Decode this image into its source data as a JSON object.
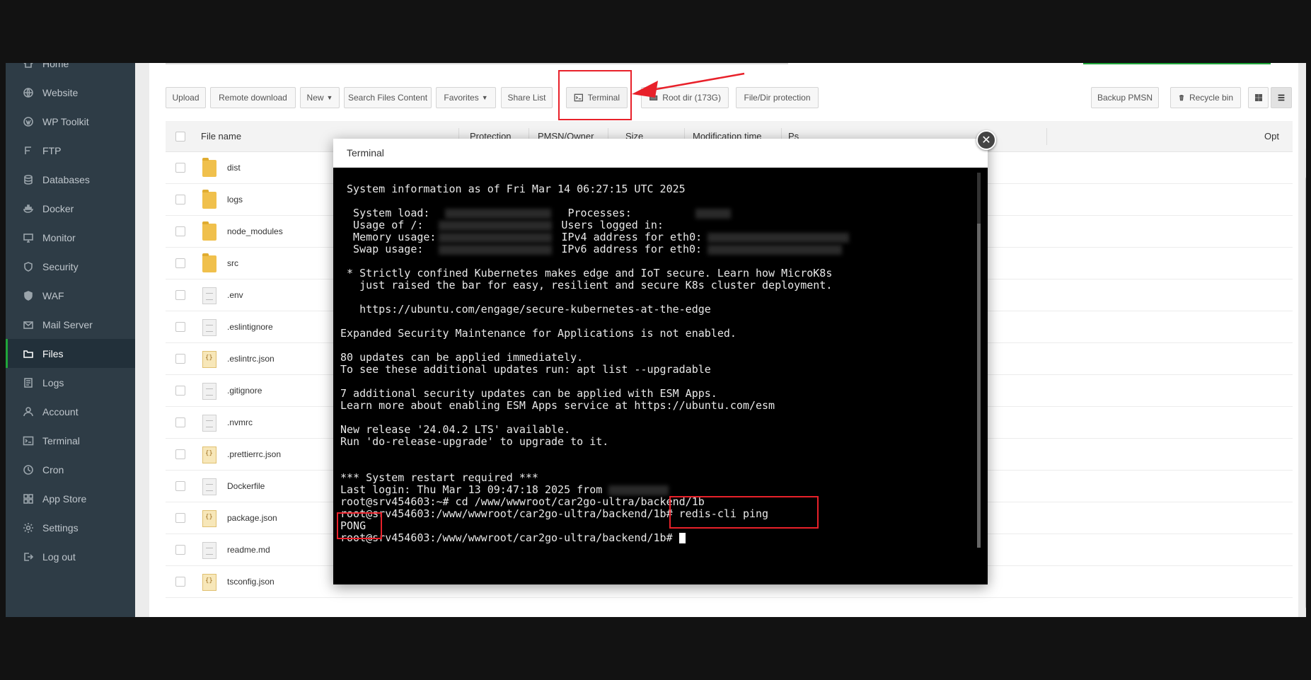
{
  "sidebar": {
    "items": [
      {
        "label": "Home",
        "icon": "home-icon"
      },
      {
        "label": "Website",
        "icon": "globe-icon"
      },
      {
        "label": "WP Toolkit",
        "icon": "wordpress-icon"
      },
      {
        "label": "FTP",
        "icon": "ftp-icon"
      },
      {
        "label": "Databases",
        "icon": "database-icon"
      },
      {
        "label": "Docker",
        "icon": "docker-icon"
      },
      {
        "label": "Monitor",
        "icon": "monitor-icon"
      },
      {
        "label": "Security",
        "icon": "shield-icon"
      },
      {
        "label": "WAF",
        "icon": "waf-shield-icon"
      },
      {
        "label": "Mail Server",
        "icon": "mail-icon"
      },
      {
        "label": "Files",
        "icon": "folder-icon",
        "active": true
      },
      {
        "label": "Logs",
        "icon": "logs-icon"
      },
      {
        "label": "Account",
        "icon": "user-icon"
      },
      {
        "label": "Terminal",
        "icon": "terminal-icon"
      },
      {
        "label": "Cron",
        "icon": "clock-icon"
      },
      {
        "label": "App Store",
        "icon": "grid-icon"
      },
      {
        "label": "Settings",
        "icon": "gear-icon"
      },
      {
        "label": "Log out",
        "icon": "logout-icon"
      }
    ]
  },
  "toolbar": {
    "upload": "Upload",
    "remote_download": "Remote download",
    "new": "New",
    "search_files": "Search Files Content",
    "favorites": "Favorites",
    "share_list": "Share List",
    "terminal": "Terminal",
    "root_dir": "Root dir (173G)",
    "file_protection": "File/Dir protection",
    "backup": "Backup PMSN",
    "recycle_bin": "Recycle bin"
  },
  "table": {
    "headers": {
      "file_name": "File name",
      "protection": "Protection",
      "owner": "PMSN/Owner",
      "size": "Size",
      "modified": "Modification time",
      "ps": "Ps",
      "opt": "Opt"
    },
    "rows": [
      {
        "name": "dist",
        "type": "folder"
      },
      {
        "name": "logs",
        "type": "folder"
      },
      {
        "name": "node_modules",
        "type": "folder"
      },
      {
        "name": "src",
        "type": "folder"
      },
      {
        "name": ".env",
        "type": "file"
      },
      {
        "name": ".eslintignore",
        "type": "file"
      },
      {
        "name": ".eslintrc.json",
        "type": "json"
      },
      {
        "name": ".gitignore",
        "type": "file"
      },
      {
        "name": ".nvmrc",
        "type": "file"
      },
      {
        "name": ".prettierrc.json",
        "type": "json"
      },
      {
        "name": "Dockerfile",
        "type": "file"
      },
      {
        "name": "package.json",
        "type": "json"
      },
      {
        "name": "readme.md",
        "type": "file"
      },
      {
        "name": "tsconfig.json",
        "type": "json"
      }
    ]
  },
  "modal": {
    "title": "Terminal"
  },
  "terminal": {
    "sysinfo": " System information as of Fri Mar 14 06:27:15 UTC 2025",
    "load_label": "  System load:",
    "processes_label": "Processes:",
    "usage_label": "  Usage of /:",
    "users_label": "Users logged in:",
    "memory_label": "  Memory usage:",
    "ipv4_label": "IPv4 address for eth0:",
    "swap_label": "  Swap usage:",
    "ipv6_label": "IPv6 address for eth0:",
    "k8s_1": " * Strictly confined Kubernetes makes edge and IoT secure. Learn how MicroK8s",
    "k8s_2": "   just raised the bar for easy, resilient and secure K8s cluster deployment.",
    "k8s_url": "   https://ubuntu.com/engage/secure-kubernetes-at-the-edge",
    "esm": "Expanded Security Maintenance for Applications is not enabled.",
    "updates_1": "80 updates can be applied immediately.",
    "updates_2": "To see these additional updates run: apt list --upgradable",
    "sec_1": "7 additional security updates can be applied with ESM Apps.",
    "sec_2": "Learn more about enabling ESM Apps service at https://ubuntu.com/esm",
    "release_1": "New release '24.04.2 LTS' available.",
    "release_2": "Run 'do-release-upgrade' to upgrade to it.",
    "restart": "*** System restart required ***",
    "last_login": "Last login: Thu Mar 13 09:47:18 2025 from ",
    "cmd_1": "root@srv454603:~# cd /www/wwwroot/car2go-ultra/backend/1b",
    "cmd_2": "root@srv454603:/www/wwwroot/car2go-ultra/backend/1b# redis-cli ping",
    "pong": "PONG",
    "prompt": "root@srv454603:/www/wwwroot/car2go-ultra/backend/1b# "
  }
}
